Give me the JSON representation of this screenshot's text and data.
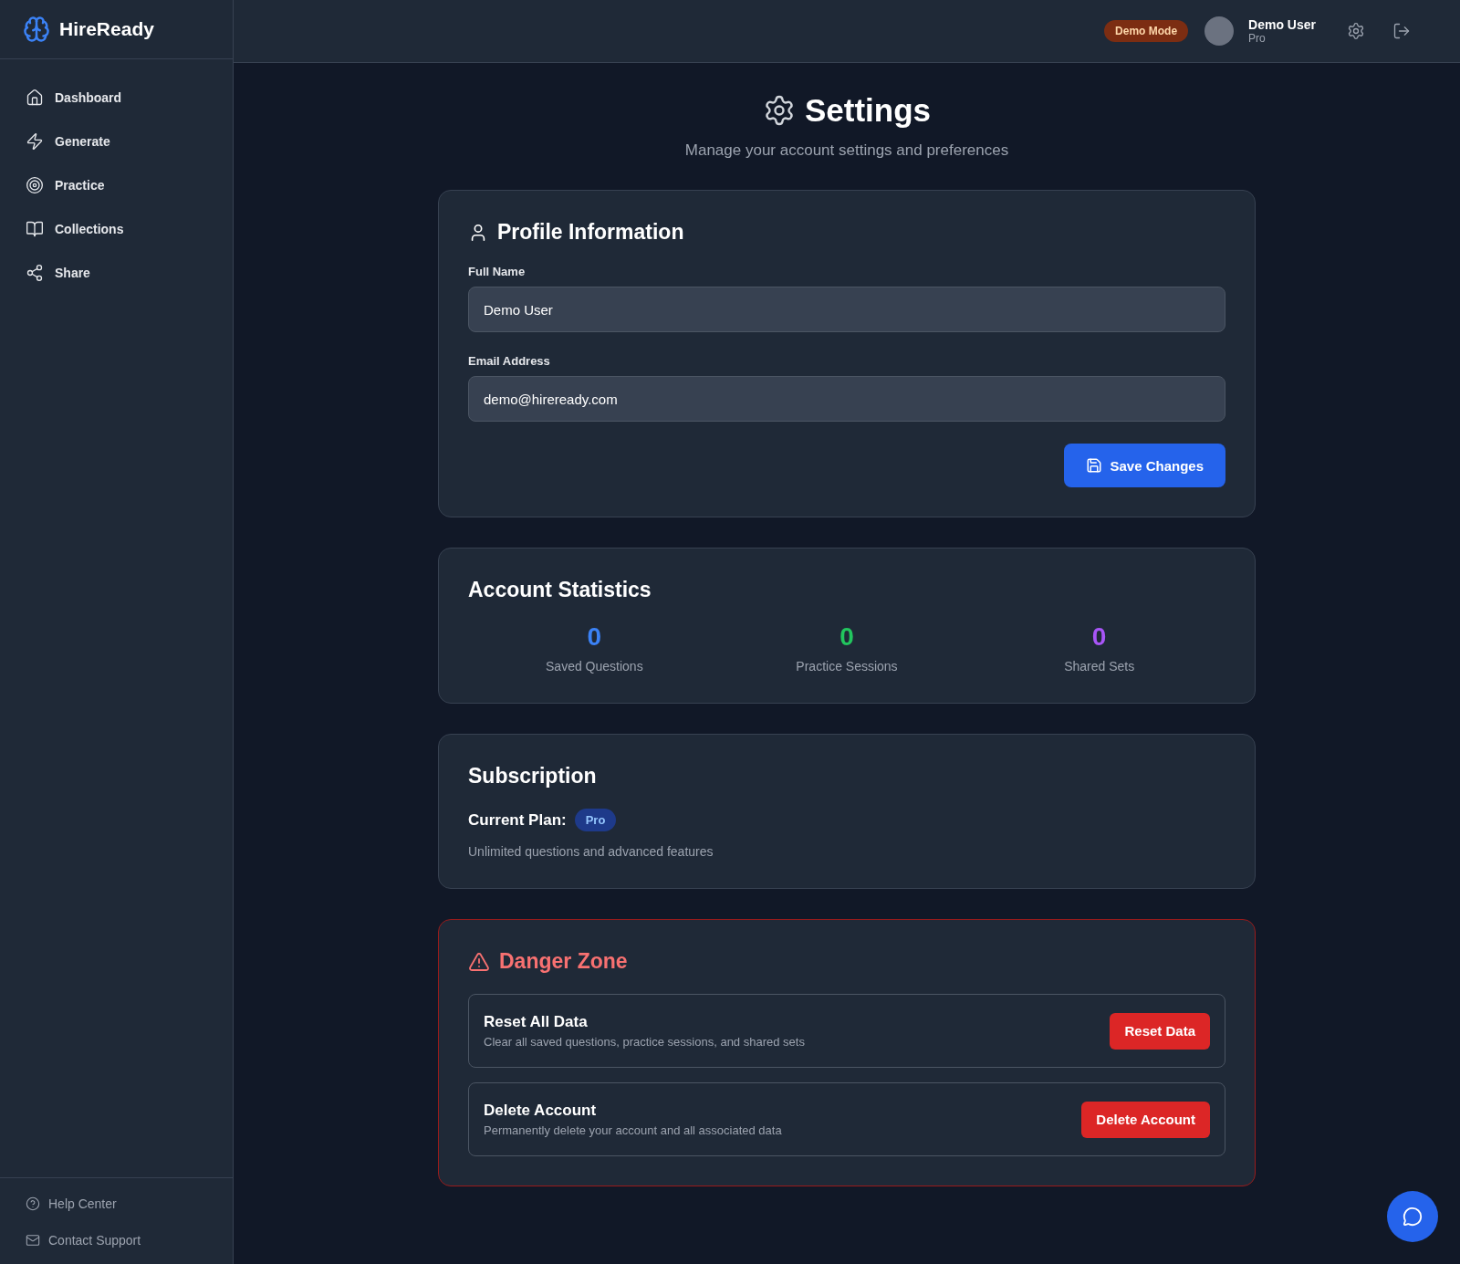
{
  "brand": {
    "name": "HireReady"
  },
  "sidebar": {
    "items": [
      {
        "label": "Dashboard",
        "kind": "home"
      },
      {
        "label": "Generate",
        "kind": "bolt"
      },
      {
        "label": "Practice",
        "kind": "target"
      },
      {
        "label": "Collections",
        "kind": "book"
      },
      {
        "label": "Share",
        "kind": "share"
      }
    ],
    "footer_links": [
      {
        "label": "Help Center",
        "kind": "help"
      },
      {
        "label": "Contact Support",
        "kind": "mail"
      }
    ]
  },
  "header": {
    "mode_badge": "Demo Mode",
    "user": {
      "name": "Demo User",
      "plan": "Pro"
    }
  },
  "page": {
    "title": "Settings",
    "subtitle": "Manage your account settings and preferences"
  },
  "profile": {
    "title": "Profile Information",
    "fields": [
      {
        "label": "Full Name",
        "value": "Demo User"
      },
      {
        "label": "Email Address",
        "value": "demo@hireready.com"
      }
    ],
    "save_button": "Save Changes"
  },
  "statistics": {
    "title": "Account Statistics",
    "items": [
      {
        "value": "0",
        "label": "Saved Questions",
        "color": "#3b82f6"
      },
      {
        "value": "0",
        "label": "Practice Sessions",
        "color": "#22c55e"
      },
      {
        "value": "0",
        "label": "Shared Sets",
        "color": "#a855f7"
      }
    ]
  },
  "subscription": {
    "title": "Subscription",
    "plan_label": "Current Plan:",
    "plan_badge": "Pro",
    "description": "Unlimited questions and advanced features"
  },
  "danger_zone": {
    "title": "Danger Zone",
    "actions": [
      {
        "title": "Reset All Data",
        "description": "Clear all saved questions, practice sessions, and shared sets",
        "button": "Reset Data"
      },
      {
        "title": "Delete Account",
        "description": "Permanently delete your account and all associated data",
        "button": "Delete Account"
      }
    ]
  }
}
